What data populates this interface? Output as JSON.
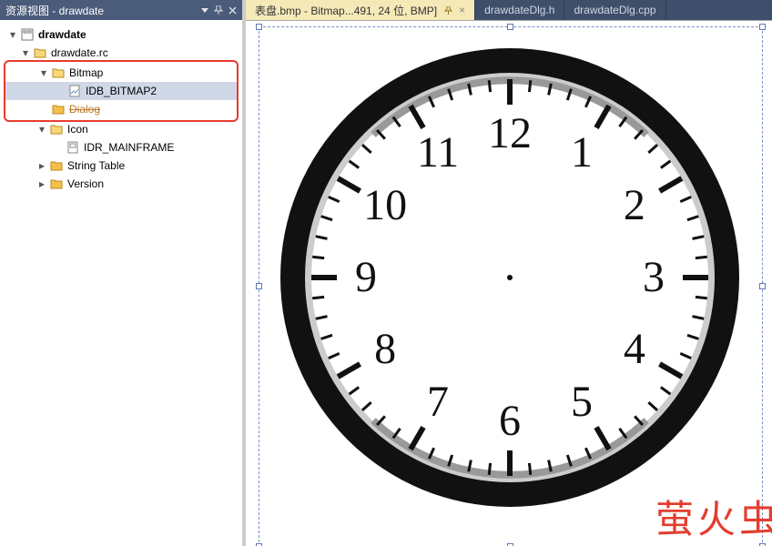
{
  "panel": {
    "title": "资源视图 - drawdate"
  },
  "tree": {
    "root": "drawdate",
    "rc": "drawdate.rc",
    "bitmap_folder": "Bitmap",
    "bitmap_item": "IDB_BITMAP2",
    "dialog_folder": "Dialog",
    "icon_folder": "Icon",
    "icon_item": "IDR_MAINFRAME",
    "stringtable_folder": "String Table",
    "version_folder": "Version"
  },
  "tabs": {
    "active": "表盘.bmp - Bitmap...491, 24 位, BMP]",
    "t2": "drawdateDlg.h",
    "t3": "drawdateDlg.cpp"
  },
  "clock": {
    "numbers": [
      "12",
      "1",
      "2",
      "3",
      "4",
      "5",
      "6",
      "7",
      "8",
      "9",
      "10",
      "11"
    ]
  },
  "watermark": "萤火虫"
}
